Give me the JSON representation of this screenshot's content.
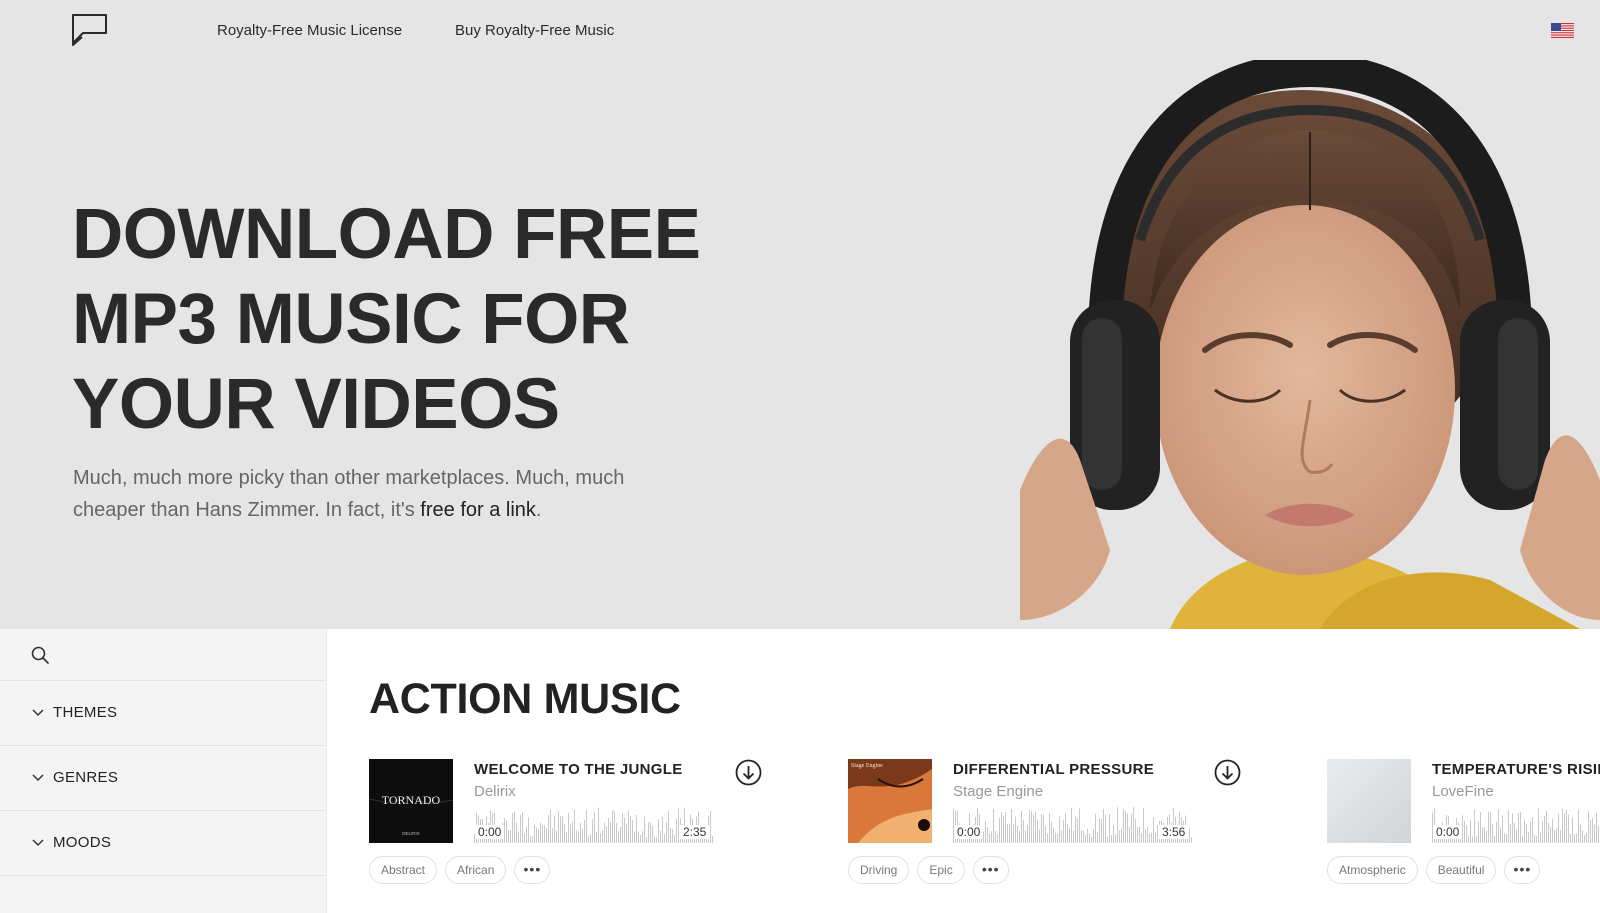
{
  "nav": {
    "license": "Royalty-Free Music License",
    "buy": "Buy Royalty-Free Music"
  },
  "hero": {
    "title_lines": [
      "DOWNLOAD FREE",
      "MP3 MUSIC FOR",
      "YOUR VIDEOS"
    ],
    "subtitle_before": "Much, much more picky than other marketplaces. Much, much cheaper than Hans Zimmer. In fact, it's ",
    "subtitle_link": "free for a link",
    "subtitle_after": "."
  },
  "sidebar": {
    "search_placeholder": "",
    "filters": [
      "THEMES",
      "GENRES",
      "MOODS"
    ]
  },
  "section": {
    "title": "ACTION MUSIC"
  },
  "tracks": [
    {
      "title": "WELCOME TO THE JUNGLE",
      "artist": "Delirix",
      "start": "0:00",
      "end": "2:35",
      "cover_text": "TORNADO",
      "cover_sub": "DELIRIX",
      "tags": [
        "Abstract",
        "African"
      ],
      "more": "•••"
    },
    {
      "title": "DIFFERENTIAL PRESSURE",
      "artist": "Stage Engine",
      "start": "0:00",
      "end": "3:56",
      "cover_text": "Stage Engine",
      "tags": [
        "Driving",
        "Epic"
      ],
      "more": "•••"
    },
    {
      "title": "TEMPERATURE'S RISING",
      "artist": "LoveFine",
      "start": "0:00",
      "tags": [
        "Atmospheric",
        "Beautiful"
      ],
      "more": "•••"
    }
  ],
  "colors": {
    "hero_bg": "#e6e5e5",
    "sidebar_bg": "#f4f4f4",
    "text": "#2b2b2b",
    "muted": "#999999"
  }
}
